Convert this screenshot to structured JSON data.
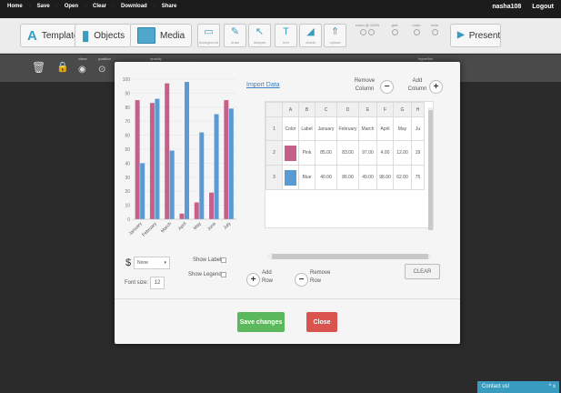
{
  "menu": [
    "Home",
    "Save",
    "Open",
    "Clear",
    "Download",
    "Share"
  ],
  "user": {
    "name": "nasha108",
    "logout": "Logout"
  },
  "toolbar": {
    "templates": "Templates",
    "objects": "Objects",
    "media": "Media",
    "tools": [
      "background",
      "draw",
      "shapes",
      "text",
      "charts",
      "upload"
    ],
    "zoom_label": "zoom @ 100%",
    "grid_label": "grid",
    "undo_label": "undo",
    "redo_label": "redo",
    "present": "Present"
  },
  "subbar": {
    "labels": [
      "clone",
      "position",
      "opacity",
      "size",
      "hyperlink"
    ]
  },
  "chart_modal": {
    "import_link": "Import Data",
    "remove_column": "Remove\nColumn",
    "add_column": "Add\nColumn",
    "add_row": "Add\nRow",
    "remove_row": "Remove\nRow",
    "clear": "CLEAR",
    "currency_symbol": "$",
    "currency_select": "None",
    "show_label": "Show Label",
    "show_legend": "Show Legend",
    "font_size_label": "Font size:",
    "font_size_value": "12",
    "save": "Save changes",
    "close": "Close"
  },
  "table": {
    "col_letters": [
      "",
      "A",
      "B",
      "C",
      "D",
      "E",
      "F",
      "G",
      "H"
    ],
    "header_row": [
      "1",
      "Color",
      "Label",
      "January",
      "February",
      "March",
      "April",
      "May",
      "Ju"
    ],
    "rows": [
      {
        "n": "2",
        "color": "#c5608a",
        "label": "Pink",
        "vals": [
          "85.00",
          "83.00",
          "97.00",
          "4.00",
          "12.00",
          "19"
        ]
      },
      {
        "n": "3",
        "color": "#5b9bd5",
        "label": "Blue",
        "vals": [
          "40.00",
          "86.00",
          "49.00",
          "98.00",
          "62.00",
          "75"
        ]
      }
    ]
  },
  "chart_data": {
    "type": "bar",
    "categories": [
      "January",
      "February",
      "March",
      "April",
      "May",
      "June",
      "July"
    ],
    "series": [
      {
        "name": "Pink",
        "color": "#c5608a",
        "values": [
          85,
          83,
          97,
          4,
          12,
          19,
          85
        ]
      },
      {
        "name": "Blue",
        "color": "#5b9bd5",
        "values": [
          40,
          86,
          49,
          98,
          62,
          75,
          79
        ]
      }
    ],
    "ylim": [
      0,
      100
    ],
    "yticks": [
      "0",
      "10",
      "20",
      "30",
      "40",
      "50",
      "60",
      "70",
      "80",
      "90",
      "100"
    ]
  },
  "footer_chat": "Contact us!",
  "colors": {
    "save": "#5cb85c",
    "close": "#d9534f",
    "accent": "#3a9bc0"
  }
}
